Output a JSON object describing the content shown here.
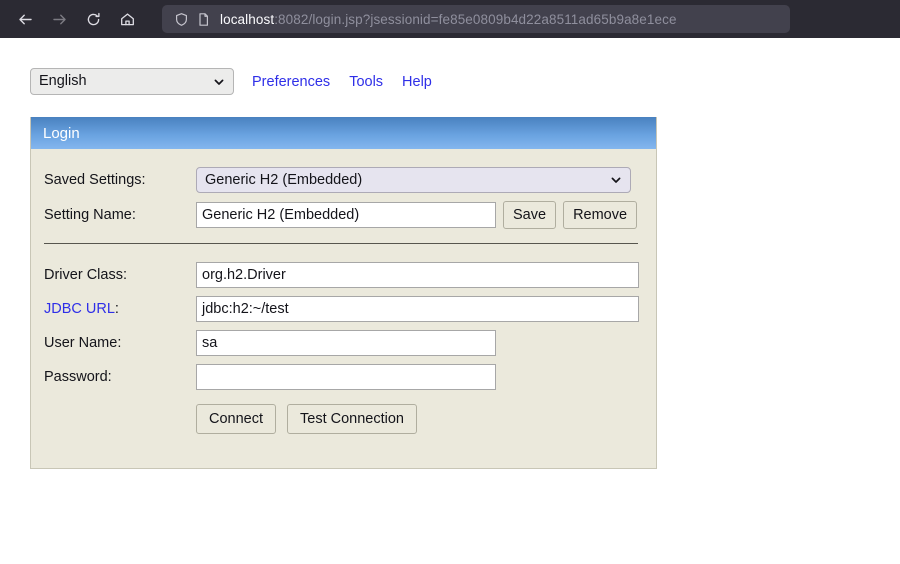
{
  "browser": {
    "nav": {
      "back_icon": "arrow-left-icon",
      "forward_icon": "arrow-right-icon",
      "reload_icon": "reload-icon",
      "home_icon": "home-icon"
    },
    "urlbar": {
      "shield_icon": "shield-icon",
      "page_icon": "page-document-icon",
      "host": "localhost",
      "path": ":8082/login.jsp?jsessionid=fe85e0809b4d22a8511ad65b9a8e1ece",
      "full_url": "localhost:8082/login.jsp?jsessionid=fe85e0809b4d22a8511ad65b9a8e1ece"
    }
  },
  "toolbar": {
    "language_value": "English",
    "language_chevron_icon": "chevron-down-icon",
    "links": [
      {
        "label": "Preferences"
      },
      {
        "label": "Tools"
      },
      {
        "label": "Help"
      }
    ]
  },
  "panel": {
    "title": "Login",
    "rows": {
      "saved_settings": {
        "label": "Saved Settings:",
        "value": "Generic H2 (Embedded)",
        "chevron_icon": "chevron-down-icon"
      },
      "setting_name": {
        "label": "Setting Name:",
        "value": "Generic H2 (Embedded)",
        "save_label": "Save",
        "remove_label": "Remove"
      },
      "driver_class": {
        "label": "Driver Class:",
        "value": "org.h2.Driver"
      },
      "jdbc_url": {
        "label": "JDBC URL",
        "label_suffix": ":",
        "value": "jdbc:h2:~/test"
      },
      "user_name": {
        "label": "User Name:",
        "value": "sa"
      },
      "password": {
        "label": "Password:",
        "value": ""
      }
    },
    "actions": {
      "connect_label": "Connect",
      "test_connection_label": "Test Connection"
    }
  },
  "colors": {
    "chrome_bg": "#2b2a33",
    "urlbar_bg": "#42414d",
    "panel_bg": "#ebe9dc",
    "header_blue_top": "#4981bf",
    "header_blue_bottom": "#84b6ee",
    "link_blue": "#2f2fe8",
    "page_bg": "#ffffff"
  }
}
